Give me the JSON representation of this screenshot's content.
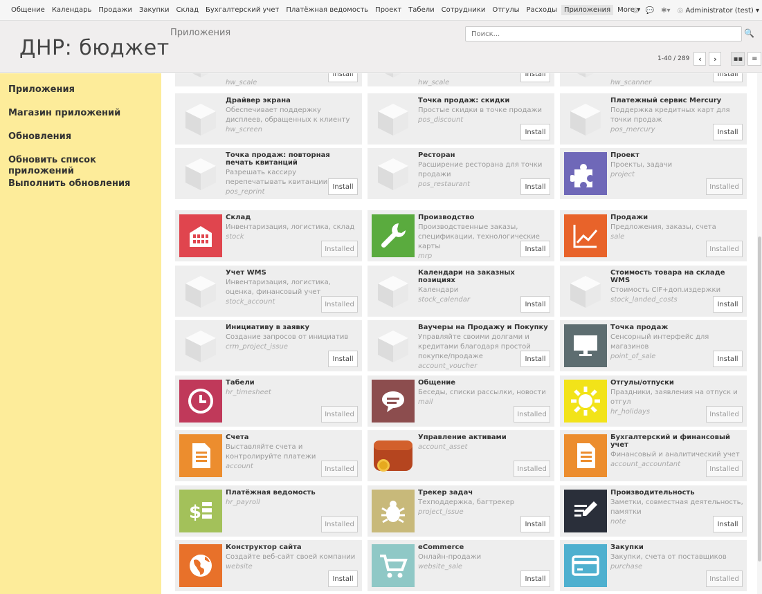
{
  "topnav": {
    "items": [
      "Общение",
      "Календарь",
      "Продажи",
      "Закупки",
      "Склад",
      "Бухгалтерский учет",
      "Платёжная ведомость",
      "Проект",
      "Табели",
      "Сотрудники",
      "Отгулы",
      "Расходы",
      "Приложения",
      "More ▾"
    ],
    "active_index": 12,
    "user": "Administrator (test)"
  },
  "header": {
    "company": "ДНР: бюджет",
    "breadcrumb": "Приложения",
    "search_placeholder": "Поиск...",
    "pager": "1-40 / 289"
  },
  "sidebar": {
    "items": [
      "Приложения",
      "Магазин приложений",
      "Обновления",
      "Обновить список приложений",
      "Выполнить обновления"
    ]
  },
  "button_labels": {
    "install": "Install",
    "installed": "Installed"
  },
  "apps": [
    {
      "name": "",
      "desc": "",
      "tech": "hw_scale",
      "status": "install",
      "icon": "cube",
      "color": "#eeeeee"
    },
    {
      "name": "",
      "desc": "",
      "tech": "hw_scale",
      "status": "install",
      "icon": "cube",
      "color": "#eeeeee"
    },
    {
      "name": "",
      "desc": "",
      "tech": "hw_scanner",
      "status": "install",
      "icon": "cube",
      "color": "#eeeeee"
    },
    {
      "name": "Драйвер экрана",
      "desc": "Обеспечивает поддержку дисплеев, обращенных к клиенту",
      "tech": "hw_screen",
      "status": "none",
      "icon": "cube",
      "color": "#eeeeee"
    },
    {
      "name": "Точка продаж: скидки",
      "desc": "Простые скидки в точке продажи",
      "tech": "pos_discount",
      "status": "install",
      "icon": "cube",
      "color": "#eeeeee"
    },
    {
      "name": "Платежный сервис Mercury",
      "desc": "Поддержка кредитных карт для точки продаж",
      "tech": "pos_mercury",
      "status": "install",
      "icon": "cube",
      "color": "#eeeeee"
    },
    {
      "name": "Точка продаж: повторная печать квитанций",
      "desc": "Разрешать кассиру перепечатывать квитанции",
      "tech": "pos_reprint",
      "status": "install",
      "icon": "cube",
      "color": "#eeeeee"
    },
    {
      "name": "Ресторан",
      "desc": "Расширение ресторана для точки продажи",
      "tech": "pos_restaurant",
      "status": "install",
      "icon": "cube",
      "color": "#eeeeee"
    },
    {
      "name": "Проект",
      "desc": "Проекты, задачи",
      "tech": "project",
      "status": "installed",
      "icon": "puzzle",
      "color": "#6f68b8"
    },
    {
      "name": "Склад",
      "desc": "Инвентаризация, логистика, склад",
      "tech": "stock",
      "status": "installed",
      "icon": "building",
      "color": "#e0454e"
    },
    {
      "name": "Производство",
      "desc": "Производственные заказы, спецификации, технологические карты",
      "tech": "mrp",
      "status": "install",
      "icon": "wrench",
      "color": "#5aab3e"
    },
    {
      "name": "Продажи",
      "desc": "Предложения, заказы, счета",
      "tech": "sale",
      "status": "installed",
      "icon": "chart",
      "color": "#e8632a"
    },
    {
      "name": "Учет WMS",
      "desc": "Инвентаризация, логистика, оценка, финансовый учет",
      "tech": "stock_account",
      "status": "installed",
      "icon": "cube",
      "color": "#eeeeee"
    },
    {
      "name": "Календари на заказных позициях",
      "desc": "Календари",
      "tech": "stock_calendar",
      "status": "install",
      "icon": "cube",
      "color": "#eeeeee"
    },
    {
      "name": "Стоимость товара на складе WMS",
      "desc": "Стоимость CIF+доп.издержки",
      "tech": "stock_landed_costs",
      "status": "install",
      "icon": "cube",
      "color": "#eeeeee"
    },
    {
      "name": "Инициативу в заявку",
      "desc": "Создание запросов от инициатив",
      "tech": "crm_project_issue",
      "status": "install",
      "icon": "cube",
      "color": "#eeeeee"
    },
    {
      "name": "Ваучеры на Продажу и Покупку",
      "desc": "Управляйте своими долгами и кредитами благодаря простой покупке/продаже",
      "tech": "account_voucher",
      "status": "install",
      "icon": "cube",
      "color": "#eeeeee"
    },
    {
      "name": "Точка продаж",
      "desc": "Сенсорный интерфейс для магазинов",
      "tech": "point_of_sale",
      "status": "install",
      "icon": "monitor",
      "color": "#5d6d70"
    },
    {
      "name": "Табели",
      "desc": "",
      "tech": "hr_timesheet",
      "status": "installed",
      "icon": "clock",
      "color": "#c0395a"
    },
    {
      "name": "Общение",
      "desc": "Беседы, списки рассылки, новости",
      "tech": "mail",
      "status": "installed",
      "icon": "chat",
      "color": "#8c4d4e"
    },
    {
      "name": "Отгулы/отпуски",
      "desc": "Праздники, заявления на отпуск и отгул",
      "tech": "hr_holidays",
      "status": "installed",
      "icon": "sun",
      "color": "#f2e319"
    },
    {
      "name": "Счета",
      "desc": "Выставляйте счета и контролируйте платежи",
      "tech": "account",
      "status": "installed",
      "icon": "doc",
      "color": "#ec8d2e"
    },
    {
      "name": "Управление активами",
      "desc": "",
      "tech": "account_asset",
      "status": "installed",
      "icon": "wallet",
      "color": "#eeeeee"
    },
    {
      "name": "Бухгалтерский и финансовый учет",
      "desc": "Финансовый и аналитический учет",
      "tech": "account_accountant",
      "status": "installed",
      "icon": "doc",
      "color": "#ec8d2e"
    },
    {
      "name": "Платёжная ведомость",
      "desc": "",
      "tech": "hr_payroll",
      "status": "installed",
      "icon": "payroll",
      "color": "#a3c15a"
    },
    {
      "name": "Трекер задач",
      "desc": "Техподдержка, багтрекер",
      "tech": "project_issue",
      "status": "install",
      "icon": "bug",
      "color": "#c8b97a"
    },
    {
      "name": "Производительность",
      "desc": "Заметки, совместная деятельность, памятки",
      "tech": "note",
      "status": "install",
      "icon": "note",
      "color": "#2a2f3a"
    },
    {
      "name": "Конструктор сайта",
      "desc": "Создайте веб-сайт своей компании",
      "tech": "website",
      "status": "install",
      "icon": "globe",
      "color": "#e8712a"
    },
    {
      "name": "eCommerce",
      "desc": "Онлайн-продажи",
      "tech": "website_sale",
      "status": "install",
      "icon": "cart",
      "color": "#8fc8c6"
    },
    {
      "name": "Закупки",
      "desc": "Закупки, счета от поставщиков",
      "tech": "purchase",
      "status": "installed",
      "icon": "card",
      "color": "#4fb0cf"
    }
  ]
}
